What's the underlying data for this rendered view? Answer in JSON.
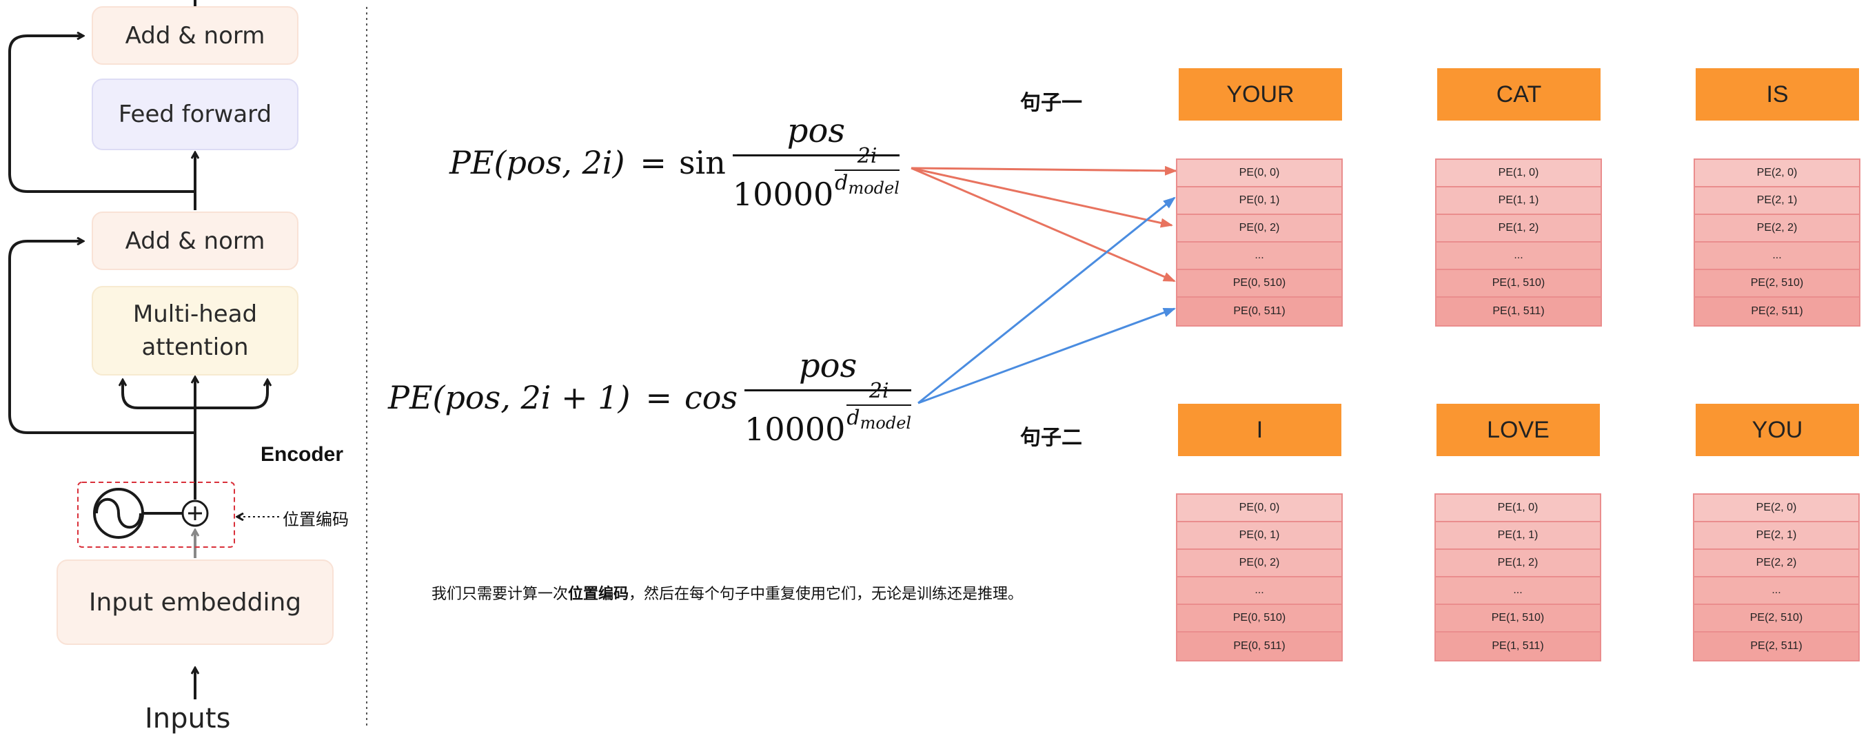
{
  "encoder": {
    "add_norm_top": "Add & norm",
    "feed_forward": "Feed forward",
    "add_norm_bottom": "Add & norm",
    "multi_head_line1": "Multi-head",
    "multi_head_line2": "attention",
    "input_embedding": "Input embedding",
    "inputs": "Inputs",
    "encoder_label": "Encoder",
    "positional_encoding_label": "位置编码"
  },
  "formulas": {
    "sin": {
      "lhs": "PE(pos, 2i)",
      "eq": "=",
      "func": "sin",
      "num": "pos",
      "den_base": "10000",
      "den_exp_top": "2i",
      "den_exp_bottom_main": "d",
      "den_exp_bottom_sub": "model"
    },
    "cos": {
      "lhs": "PE(pos, 2i + 1)",
      "eq": "=",
      "func": "cos",
      "num": "pos",
      "den_base": "10000",
      "den_exp_top": "2i",
      "den_exp_bottom_main": "d",
      "den_exp_bottom_sub": "model"
    }
  },
  "sentences": [
    {
      "label": "句子一",
      "words": [
        "YOUR",
        "CAT",
        "IS"
      ]
    },
    {
      "label": "句子二",
      "words": [
        "I",
        "LOVE",
        "YOU"
      ]
    }
  ],
  "pe_tables": [
    [
      "PE(0, 0)",
      "PE(0, 1)",
      "PE(0, 2)",
      "...",
      "PE(0, 510)",
      "PE(0, 511)"
    ],
    [
      "PE(1, 0)",
      "PE(1, 1)",
      "PE(1, 2)",
      "...",
      "PE(1, 510)",
      "PE(1, 511)"
    ],
    [
      "PE(2, 0)",
      "PE(2, 1)",
      "PE(2, 2)",
      "...",
      "PE(2, 510)",
      "PE(2, 511)"
    ]
  ],
  "note": {
    "before": "我们只需要计算一次",
    "bold": "位置编码",
    "after": "，然后在每个句子中重复使用它们，无论是训练还是推理。"
  },
  "colors": {
    "word_fill": "#fa9631",
    "pe_fill_top": "#f7c4c2",
    "pe_fill_bottom": "#f2a39f",
    "arrow_sin": "#e8735f",
    "arrow_cos": "#4a8ce0",
    "pe_dash_box": "#d9303a"
  }
}
